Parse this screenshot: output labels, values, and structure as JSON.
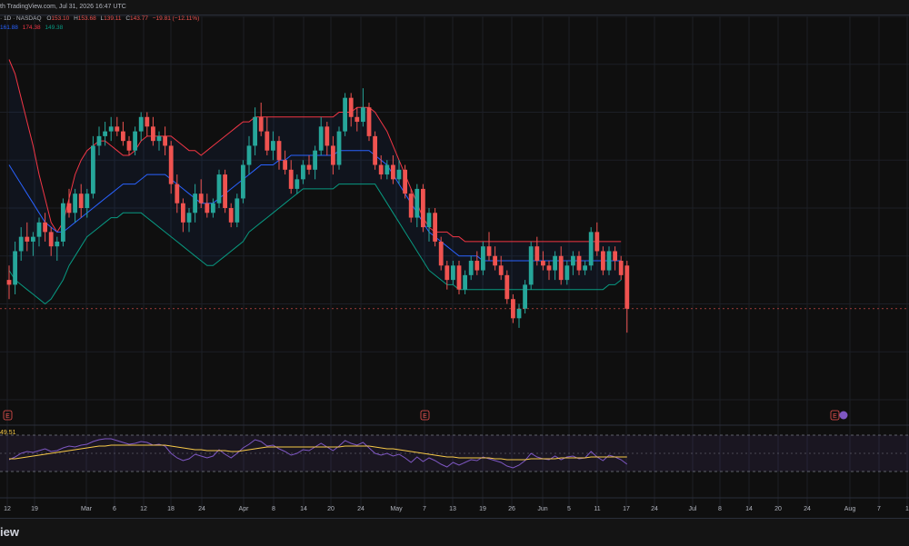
{
  "header": {
    "title_text": "th TradingView.com, Jul 31, 2026 16:47 UTC"
  },
  "legend": {
    "symbol_line": "· 1D · NASDAQ",
    "open_label": "O",
    "open_value": "153.10",
    "high_label": "H",
    "high_value": "153.68",
    "low_label": "L",
    "low_value": "139.11",
    "close_label": "C",
    "close_value": "143.77",
    "change_value": "−19.81 (−12.11%)",
    "bb_basis": "161.88",
    "bb_upper": "174.38",
    "bb_lower": "149.38"
  },
  "rsi": {
    "value_label": "49.51"
  },
  "earnings_marker": "E",
  "footer": {
    "brand": "iew"
  },
  "colors": {
    "up": "#26a69a",
    "down": "#ef5350",
    "basis": "#2962ff",
    "upper": "#f23645",
    "lower": "#089981",
    "rsi_line": "#7e57c2",
    "rsi_ma": "#f7c948"
  },
  "chart_data": {
    "type": "candlestick",
    "x_tick_labels": [
      "12",
      "19",
      "Mar",
      "6",
      "12",
      "18",
      "24",
      "Apr",
      "8",
      "14",
      "20",
      "24",
      "May",
      "7",
      "13",
      "19",
      "26",
      "Jun",
      "5",
      "11",
      "17",
      "24",
      "Jul",
      "8",
      "14",
      "20",
      "24",
      "Aug",
      "7",
      "1"
    ],
    "ylim": [
      125,
      205
    ],
    "candles": [
      [
        150,
        153,
        146,
        149
      ],
      [
        149,
        158,
        147,
        156
      ],
      [
        156,
        161,
        154,
        159
      ],
      [
        159,
        162,
        156,
        158
      ],
      [
        158,
        160,
        155,
        159
      ],
      [
        159,
        163,
        157,
        162
      ],
      [
        162,
        164,
        158,
        160
      ],
      [
        160,
        161,
        155,
        157
      ],
      [
        157,
        159,
        154,
        158
      ],
      [
        158,
        167,
        157,
        166
      ],
      [
        166,
        169,
        163,
        164
      ],
      [
        164,
        169,
        162,
        168
      ],
      [
        168,
        170,
        163,
        165
      ],
      [
        165,
        169,
        163,
        168
      ],
      [
        168,
        180,
        167,
        178
      ],
      [
        178,
        182,
        176,
        180
      ],
      [
        180,
        183,
        178,
        181
      ],
      [
        181,
        184,
        179,
        182
      ],
      [
        182,
        184,
        180,
        181
      ],
      [
        181,
        183,
        178,
        179
      ],
      [
        179,
        180,
        176,
        177
      ],
      [
        177,
        182,
        176,
        181
      ],
      [
        181,
        185,
        179,
        184
      ],
      [
        184,
        185,
        180,
        182
      ],
      [
        182,
        184,
        178,
        179
      ],
      [
        179,
        181,
        177,
        180
      ],
      [
        180,
        182,
        176,
        178
      ],
      [
        178,
        179,
        168,
        170
      ],
      [
        170,
        172,
        164,
        166
      ],
      [
        166,
        167,
        160,
        162
      ],
      [
        162,
        165,
        160,
        164
      ],
      [
        164,
        170,
        162,
        168
      ],
      [
        168,
        171,
        165,
        166
      ],
      [
        166,
        168,
        163,
        164
      ],
      [
        164,
        167,
        163,
        166
      ],
      [
        166,
        173,
        165,
        172
      ],
      [
        172,
        173,
        164,
        165
      ],
      [
        165,
        166,
        161,
        162
      ],
      [
        162,
        168,
        161,
        167
      ],
      [
        167,
        175,
        166,
        174
      ],
      [
        174,
        180,
        172,
        178
      ],
      [
        178,
        186,
        176,
        184
      ],
      [
        184,
        187,
        180,
        181
      ],
      [
        181,
        184,
        176,
        177
      ],
      [
        177,
        181,
        175,
        179
      ],
      [
        179,
        180,
        173,
        175
      ],
      [
        175,
        177,
        172,
        173
      ],
      [
        173,
        175,
        168,
        169
      ],
      [
        169,
        172,
        168,
        171
      ],
      [
        171,
        175,
        170,
        174
      ],
      [
        174,
        176,
        172,
        173
      ],
      [
        173,
        178,
        171,
        177
      ],
      [
        177,
        184,
        176,
        182
      ],
      [
        182,
        183,
        176,
        178
      ],
      [
        178,
        180,
        172,
        174
      ],
      [
        174,
        182,
        173,
        181
      ],
      [
        181,
        189,
        180,
        188
      ],
      [
        188,
        189,
        182,
        184
      ],
      [
        184,
        186,
        181,
        183
      ],
      [
        183,
        190,
        182,
        186
      ],
      [
        186,
        187,
        179,
        180
      ],
      [
        180,
        181,
        173,
        174
      ],
      [
        174,
        176,
        171,
        172
      ],
      [
        172,
        175,
        171,
        174
      ],
      [
        174,
        176,
        170,
        171
      ],
      [
        171,
        175,
        170,
        173
      ],
      [
        173,
        174,
        167,
        168
      ],
      [
        168,
        169,
        162,
        163
      ],
      [
        163,
        170,
        161,
        169
      ],
      [
        169,
        170,
        160,
        161
      ],
      [
        161,
        165,
        158,
        164
      ],
      [
        164,
        165,
        157,
        158
      ],
      [
        158,
        159,
        152,
        153
      ],
      [
        153,
        154,
        148,
        150
      ],
      [
        150,
        154,
        149,
        153
      ],
      [
        153,
        154,
        147,
        148
      ],
      [
        148,
        152,
        147,
        151
      ],
      [
        151,
        155,
        150,
        154
      ],
      [
        154,
        156,
        151,
        152
      ],
      [
        152,
        158,
        151,
        157
      ],
      [
        157,
        160,
        154,
        155
      ],
      [
        155,
        157,
        152,
        153
      ],
      [
        153,
        155,
        150,
        151
      ],
      [
        151,
        152,
        145,
        146
      ],
      [
        146,
        147,
        141,
        142
      ],
      [
        142,
        145,
        140,
        144
      ],
      [
        144,
        150,
        143,
        149
      ],
      [
        149,
        158,
        148,
        157
      ],
      [
        157,
        159,
        153,
        154
      ],
      [
        154,
        156,
        152,
        153
      ],
      [
        153,
        154,
        150,
        152
      ],
      [
        152,
        156,
        150,
        155
      ],
      [
        155,
        157,
        149,
        150
      ],
      [
        150,
        154,
        149,
        153
      ],
      [
        153,
        156,
        151,
        155
      ],
      [
        155,
        156,
        151,
        152
      ],
      [
        152,
        154,
        151,
        153
      ],
      [
        153,
        161,
        152,
        160
      ],
      [
        160,
        162,
        155,
        156
      ],
      [
        156,
        157,
        151,
        152
      ],
      [
        152,
        157,
        151,
        156
      ],
      [
        156,
        157,
        152,
        154
      ],
      [
        154,
        155,
        150,
        151
      ],
      [
        153,
        154,
        139,
        144
      ]
    ],
    "bb_upper": [
      196,
      193,
      188,
      183,
      178,
      172,
      167,
      162,
      160,
      162,
      167,
      172,
      175,
      177,
      178,
      179,
      179,
      178,
      177,
      176,
      176,
      177,
      179,
      180,
      180,
      180,
      180,
      180,
      179,
      178,
      177,
      177,
      176,
      177,
      178,
      179,
      180,
      181,
      182,
      183,
      183,
      184,
      184,
      184,
      184,
      184,
      184,
      184,
      184,
      184,
      184,
      184,
      184,
      184,
      184,
      185,
      185,
      185,
      186,
      186,
      186,
      185,
      183,
      181,
      178,
      175,
      172,
      169,
      166,
      163,
      161,
      160,
      160,
      160,
      159,
      159,
      158,
      158,
      158,
      158,
      158,
      158,
      158,
      158,
      158,
      158,
      158,
      158,
      158,
      158,
      158,
      158,
      158,
      158,
      158,
      158,
      158,
      158,
      158,
      158,
      158,
      158,
      158
    ],
    "bb_basis": [
      174,
      172,
      170,
      168,
      166,
      164,
      162,
      161,
      160,
      160,
      161,
      162,
      163,
      164,
      165,
      166,
      167,
      168,
      169,
      170,
      170,
      170,
      171,
      172,
      172,
      172,
      172,
      171,
      170,
      169,
      168,
      167,
      166,
      166,
      166,
      167,
      168,
      169,
      170,
      171,
      172,
      173,
      174,
      174,
      174,
      175,
      175,
      176,
      176,
      176,
      176,
      176,
      176,
      176,
      176,
      177,
      177,
      177,
      177,
      177,
      177,
      176,
      175,
      174,
      172,
      170,
      168,
      166,
      164,
      162,
      160,
      159,
      158,
      157,
      156,
      155,
      155,
      155,
      155,
      154,
      154,
      154,
      154,
      154,
      154,
      154,
      154,
      154,
      154,
      154,
      154,
      154,
      154,
      154,
      154,
      154,
      154,
      154,
      154,
      154,
      154,
      154,
      154
    ],
    "bb_lower": [
      152,
      150,
      149,
      148,
      147,
      146,
      145,
      146,
      148,
      150,
      153,
      155,
      157,
      159,
      160,
      161,
      162,
      163,
      163,
      164,
      164,
      164,
      164,
      163,
      162,
      161,
      160,
      159,
      158,
      157,
      156,
      155,
      154,
      153,
      153,
      154,
      155,
      156,
      157,
      158,
      160,
      161,
      162,
      163,
      164,
      165,
      166,
      167,
      168,
      169,
      169,
      169,
      169,
      169,
      169,
      170,
      170,
      170,
      170,
      170,
      170,
      170,
      168,
      166,
      164,
      162,
      160,
      158,
      156,
      154,
      152,
      151,
      150,
      149,
      149,
      148,
      148,
      148,
      148,
      148,
      148,
      148,
      148,
      148,
      148,
      148,
      148,
      148,
      148,
      148,
      148,
      148,
      148,
      148,
      148,
      148,
      148,
      148,
      148,
      148,
      149,
      149,
      150
    ],
    "rsi": [
      43,
      46,
      50,
      52,
      51,
      53,
      55,
      52,
      53,
      56,
      58,
      57,
      59,
      60,
      63,
      65,
      66,
      66,
      64,
      62,
      60,
      61,
      63,
      62,
      59,
      60,
      58,
      50,
      45,
      42,
      44,
      49,
      47,
      45,
      47,
      54,
      49,
      45,
      50,
      56,
      60,
      65,
      63,
      58,
      59,
      55,
      52,
      48,
      50,
      54,
      53,
      57,
      61,
      57,
      53,
      58,
      64,
      61,
      59,
      62,
      56,
      50,
      48,
      50,
      47,
      49,
      45,
      40,
      46,
      41,
      45,
      42,
      38,
      35,
      40,
      37,
      40,
      43,
      42,
      46,
      44,
      42,
      40,
      36,
      34,
      37,
      42,
      50,
      46,
      44,
      43,
      47,
      43,
      46,
      47,
      44,
      45,
      52,
      46,
      42,
      48,
      46,
      43,
      38
    ],
    "rsi_ma": [
      44,
      44,
      45,
      46,
      47,
      48,
      49,
      50,
      51,
      52,
      53,
      54,
      55,
      56,
      57,
      58,
      58,
      59,
      59,
      59,
      59,
      59,
      59,
      59,
      59,
      59,
      59,
      58,
      57,
      56,
      55,
      54,
      54,
      53,
      53,
      53,
      53,
      52,
      52,
      53,
      54,
      55,
      56,
      57,
      57,
      57,
      57,
      57,
      57,
      57,
      57,
      57,
      57,
      57,
      57,
      57,
      58,
      58,
      58,
      58,
      58,
      57,
      56,
      55,
      55,
      54,
      53,
      52,
      51,
      50,
      49,
      48,
      47,
      46,
      46,
      45,
      45,
      45,
      45,
      45,
      45,
      44,
      44,
      43,
      43,
      43,
      43,
      44,
      44,
      44,
      44,
      44,
      45,
      45,
      45,
      45,
      45,
      46,
      46,
      46,
      46,
      46,
      46,
      46
    ]
  }
}
